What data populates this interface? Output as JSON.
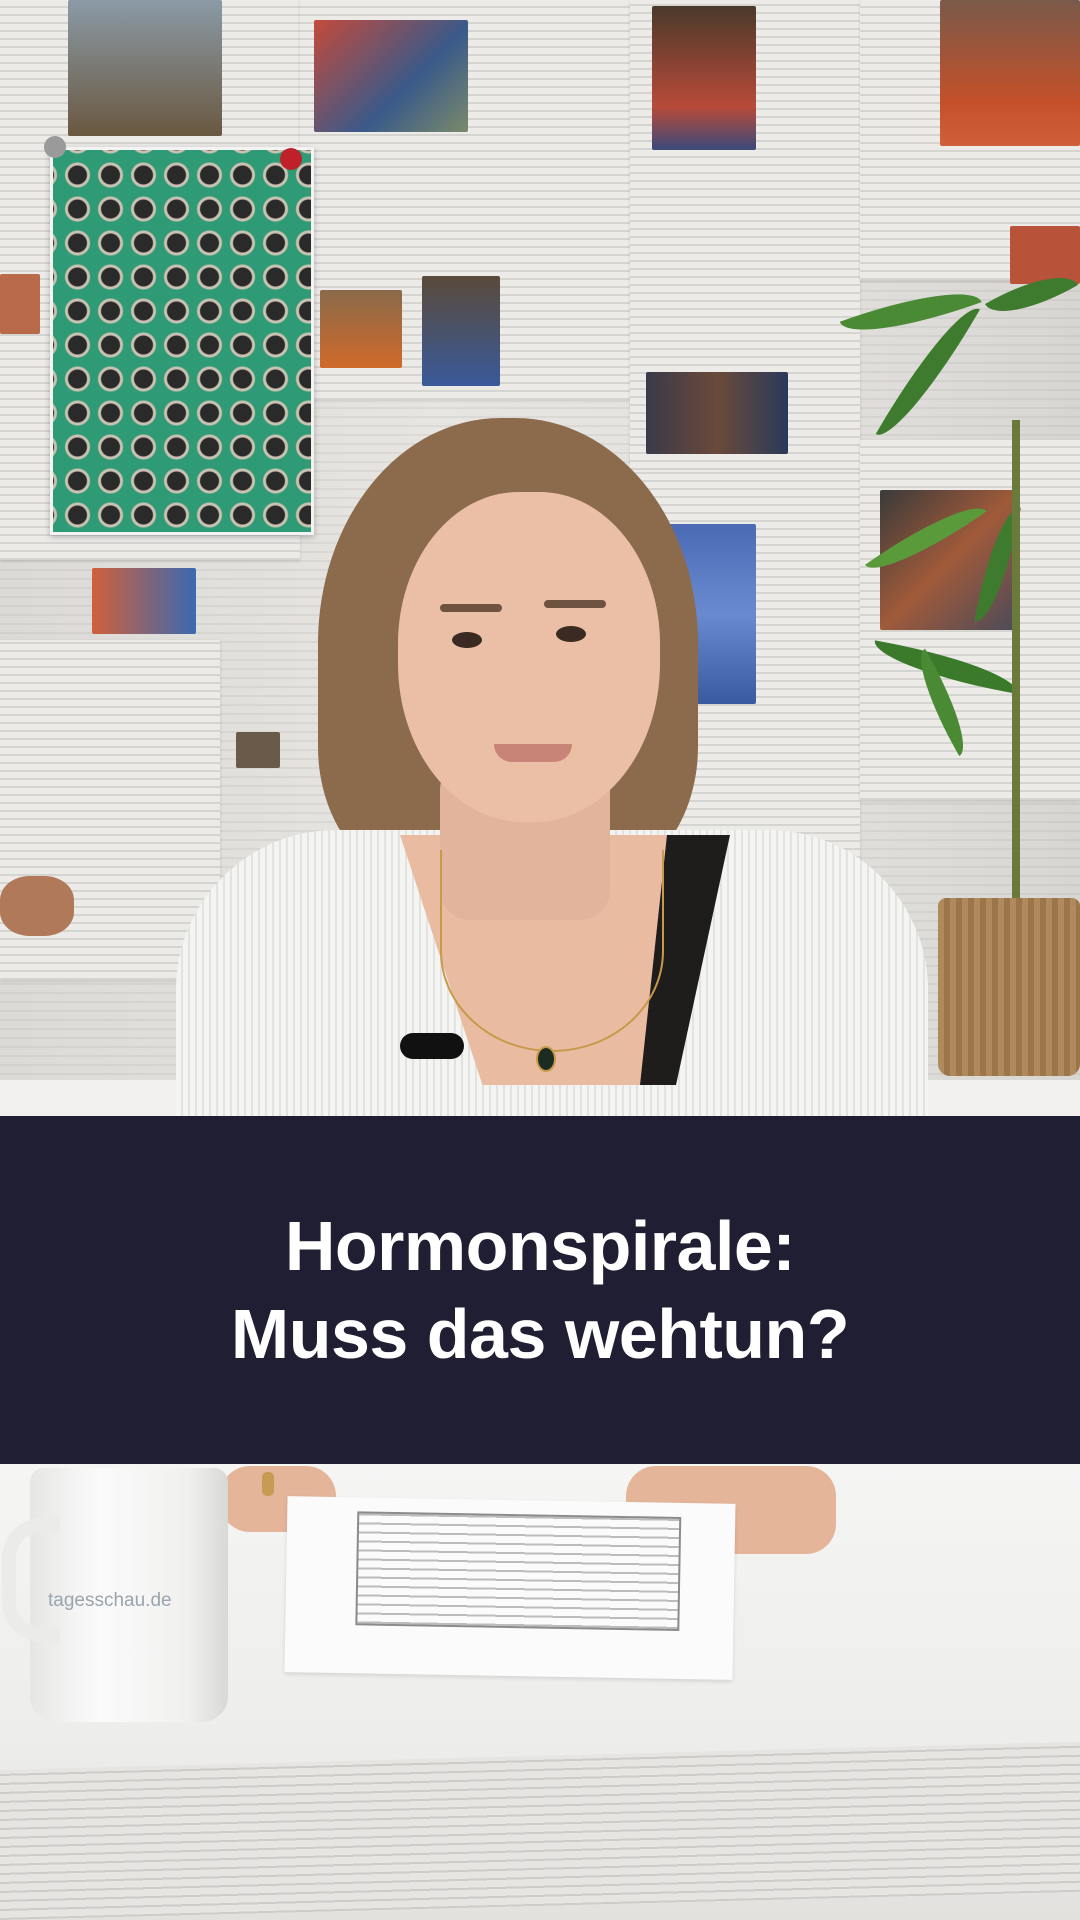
{
  "banner": {
    "line1": "Hormonspirale:",
    "line2": "Muss das wehtun?",
    "background_color": "#1f1e33",
    "text_color": "#ffffff"
  },
  "mug": {
    "label": "tagesschau.de"
  }
}
